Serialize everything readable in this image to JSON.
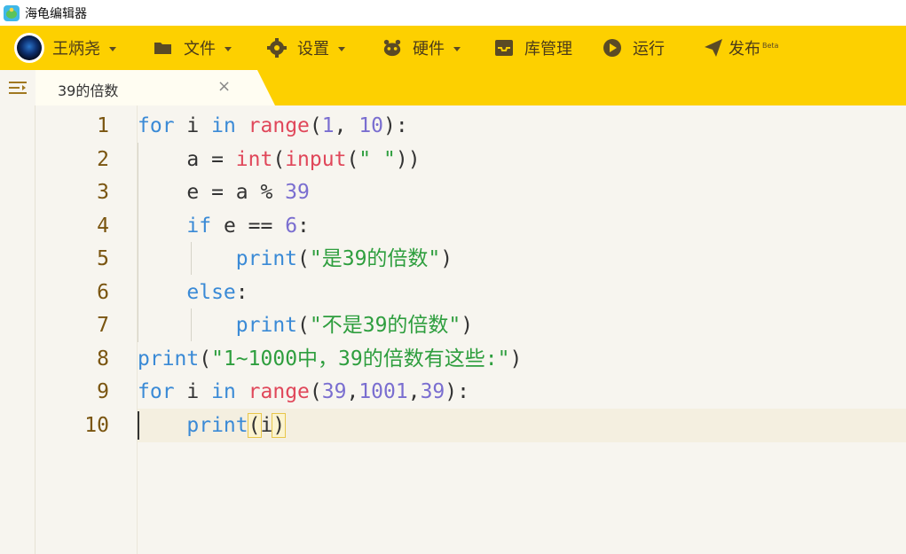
{
  "window": {
    "title": "海龟编辑器"
  },
  "menu": {
    "user": "王炳尧",
    "file": "文件",
    "settings": "设置",
    "hardware": "硬件",
    "library": "库管理",
    "run": "运行",
    "publish": "发布",
    "publish_badge": "Beta"
  },
  "tab": {
    "title": "39的倍数",
    "close": "×"
  },
  "line_numbers": [
    "1",
    "2",
    "3",
    "4",
    "5",
    "6",
    "7",
    "8",
    "9",
    "10"
  ],
  "code": [
    [
      [
        "kw",
        "for"
      ],
      [
        "p",
        " i "
      ],
      [
        "kw",
        "in"
      ],
      [
        "p",
        " "
      ],
      [
        "fn",
        "range"
      ],
      [
        "p",
        "("
      ],
      [
        "num",
        "1"
      ],
      [
        "p",
        ", "
      ],
      [
        "num",
        "10"
      ],
      [
        "p",
        "):"
      ]
    ],
    [
      [
        "p",
        "    a = "
      ],
      [
        "fn",
        "int"
      ],
      [
        "p",
        "("
      ],
      [
        "fn",
        "input"
      ],
      [
        "p",
        "("
      ],
      [
        "str",
        "\" \""
      ],
      [
        "p",
        "))"
      ]
    ],
    [
      [
        "p",
        "    e = a % "
      ],
      [
        "num",
        "39"
      ]
    ],
    [
      [
        "p",
        "    "
      ],
      [
        "kw",
        "if"
      ],
      [
        "p",
        " e == "
      ],
      [
        "num",
        "6"
      ],
      [
        "p",
        ":"
      ]
    ],
    [
      [
        "p",
        "        "
      ],
      [
        "kw",
        "print"
      ],
      [
        "p",
        "("
      ],
      [
        "str",
        "\"是39的倍数\""
      ],
      [
        "p",
        ")"
      ]
    ],
    [
      [
        "p",
        "    "
      ],
      [
        "kw",
        "else"
      ],
      [
        "p",
        ":"
      ]
    ],
    [
      [
        "p",
        "        "
      ],
      [
        "kw",
        "print"
      ],
      [
        "p",
        "("
      ],
      [
        "str",
        "\"不是39的倍数\""
      ],
      [
        "p",
        ")"
      ]
    ],
    [
      [
        "kw",
        "print"
      ],
      [
        "p",
        "("
      ],
      [
        "str",
        "\"1~1000中，39的倍数有这些:\""
      ],
      [
        "p",
        ")"
      ]
    ],
    [
      [
        "kw",
        "for"
      ],
      [
        "p",
        " i "
      ],
      [
        "kw",
        "in"
      ],
      [
        "p",
        " "
      ],
      [
        "fn",
        "range"
      ],
      [
        "p",
        "("
      ],
      [
        "num",
        "39"
      ],
      [
        "p",
        ","
      ],
      [
        "num",
        "1001"
      ],
      [
        "p",
        ","
      ],
      [
        "num",
        "39"
      ],
      [
        "p",
        "):"
      ]
    ],
    [
      [
        "p",
        "    "
      ],
      [
        "kw",
        "print"
      ],
      [
        "pb",
        "("
      ],
      [
        "p",
        "i"
      ],
      [
        "pb",
        ")"
      ]
    ]
  ],
  "colors": {
    "menubar": "#fdd000",
    "keyword": "#3a8ad6",
    "builtin": "#e0475a",
    "number": "#7a6ed0",
    "string": "#2e9e3e"
  }
}
